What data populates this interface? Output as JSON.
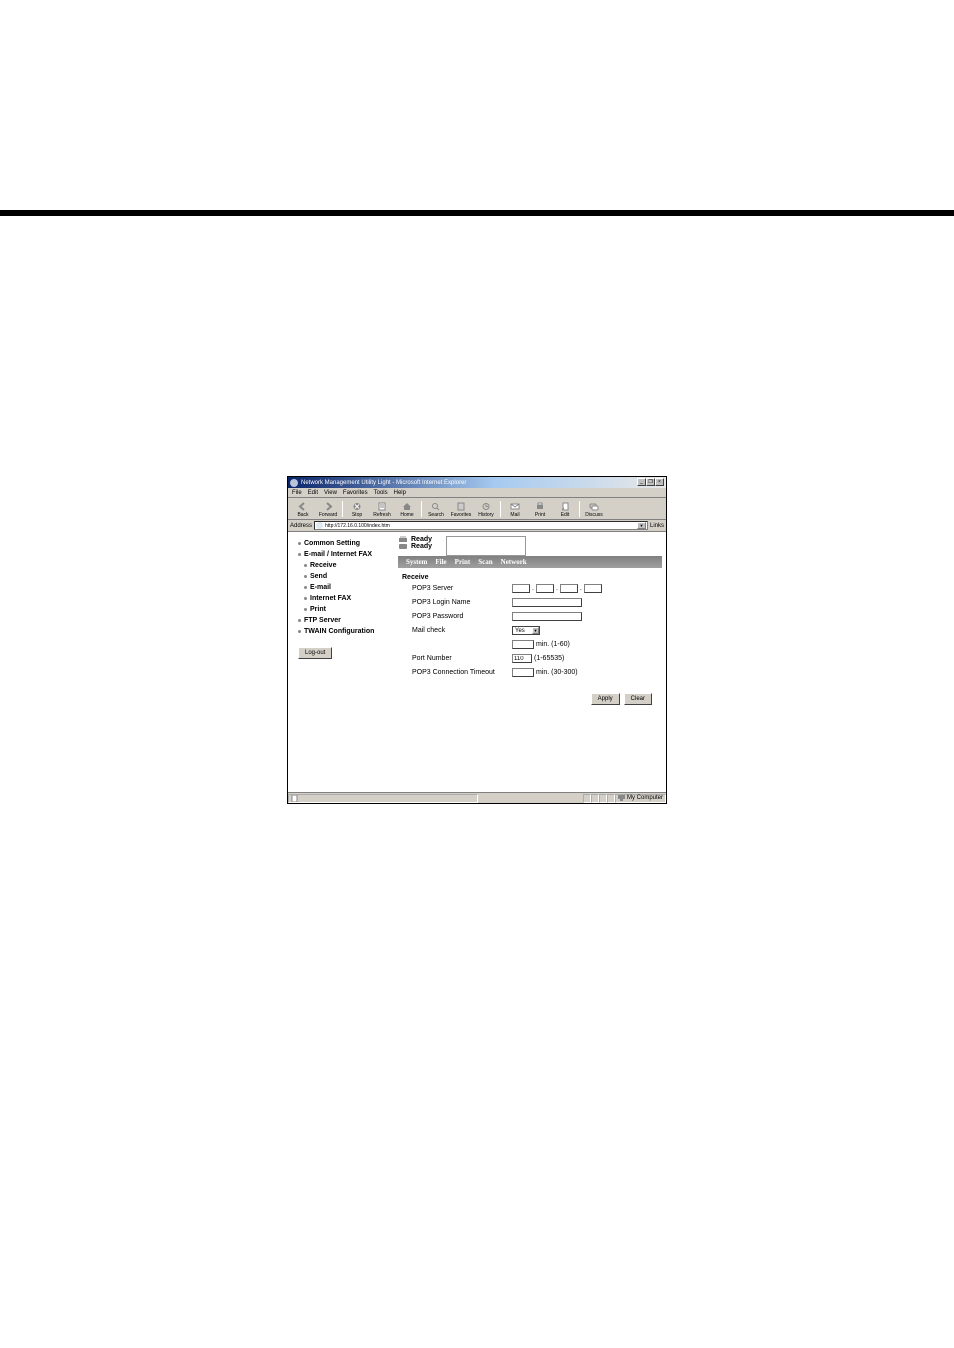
{
  "window_title": "Network Management Utility Light - Microsoft Internet Explorer",
  "menubar": [
    "File",
    "Edit",
    "View",
    "Favorites",
    "Tools",
    "Help"
  ],
  "toolbar": [
    {
      "label": "Back",
      "icon": "back-icon"
    },
    {
      "label": "Forward",
      "icon": "forward-icon"
    },
    {
      "label": "Stop",
      "icon": "stop-icon"
    },
    {
      "label": "Refresh",
      "icon": "refresh-icon"
    },
    {
      "label": "Home",
      "icon": "home-icon"
    },
    {
      "label": "Search",
      "icon": "search-icon"
    },
    {
      "label": "Favorites",
      "icon": "favorites-icon"
    },
    {
      "label": "History",
      "icon": "history-icon"
    },
    {
      "label": "Mail",
      "icon": "mail-icon"
    },
    {
      "label": "Print",
      "icon": "print-icon"
    },
    {
      "label": "Edit",
      "icon": "edit-icon"
    },
    {
      "label": "Discuss",
      "icon": "discuss-icon"
    }
  ],
  "addressbar": {
    "label": "Address",
    "url": "http://172.16.0.100/index.htm",
    "links_label": "Links"
  },
  "sidebar": {
    "items": [
      {
        "label": "Common Setting",
        "bold": true,
        "sub": false
      },
      {
        "label": "E-mail / Internet FAX",
        "bold": true,
        "sub": false
      },
      {
        "label": "Receive",
        "bold": true,
        "sub": true
      },
      {
        "label": "Send",
        "bold": true,
        "sub": true
      },
      {
        "label": "E-mail",
        "bold": true,
        "sub": true
      },
      {
        "label": "Internet FAX",
        "bold": true,
        "sub": true
      },
      {
        "label": "Print",
        "bold": true,
        "sub": true
      },
      {
        "label": "FTP Server",
        "bold": true,
        "sub": false
      },
      {
        "label": "TWAIN Configuration",
        "bold": true,
        "sub": false
      }
    ],
    "logout": "Log-out"
  },
  "header": {
    "ready1": "Ready",
    "ready2": "Ready",
    "tabs": [
      "System",
      "File",
      "Print",
      "Scan",
      "Network"
    ]
  },
  "form": {
    "title": "Receive",
    "pop3server_label": "POP3 Server",
    "pop3server_ip": [
      "",
      "",
      "",
      ""
    ],
    "pop3login_label": "POP3 Login Name",
    "pop3login_val": "",
    "pop3pw_label": "POP3 Password",
    "pop3pw_val": "",
    "mailcheck_label": "Mail check",
    "mailcheck_sel": "Yes",
    "mailcheck_interval": "",
    "mailcheck_hint": "min. (1-60)",
    "port_label": "Port Number",
    "port_val": "110",
    "port_hint": "(1-65535)",
    "timeout_label": "POP3 Connection Timeout",
    "timeout_val": "",
    "timeout_hint": "min. (30-300)",
    "apply_btn": "Apply",
    "clear_btn": "Clear"
  },
  "statusbar": {
    "done": "",
    "zone": "My Computer"
  }
}
